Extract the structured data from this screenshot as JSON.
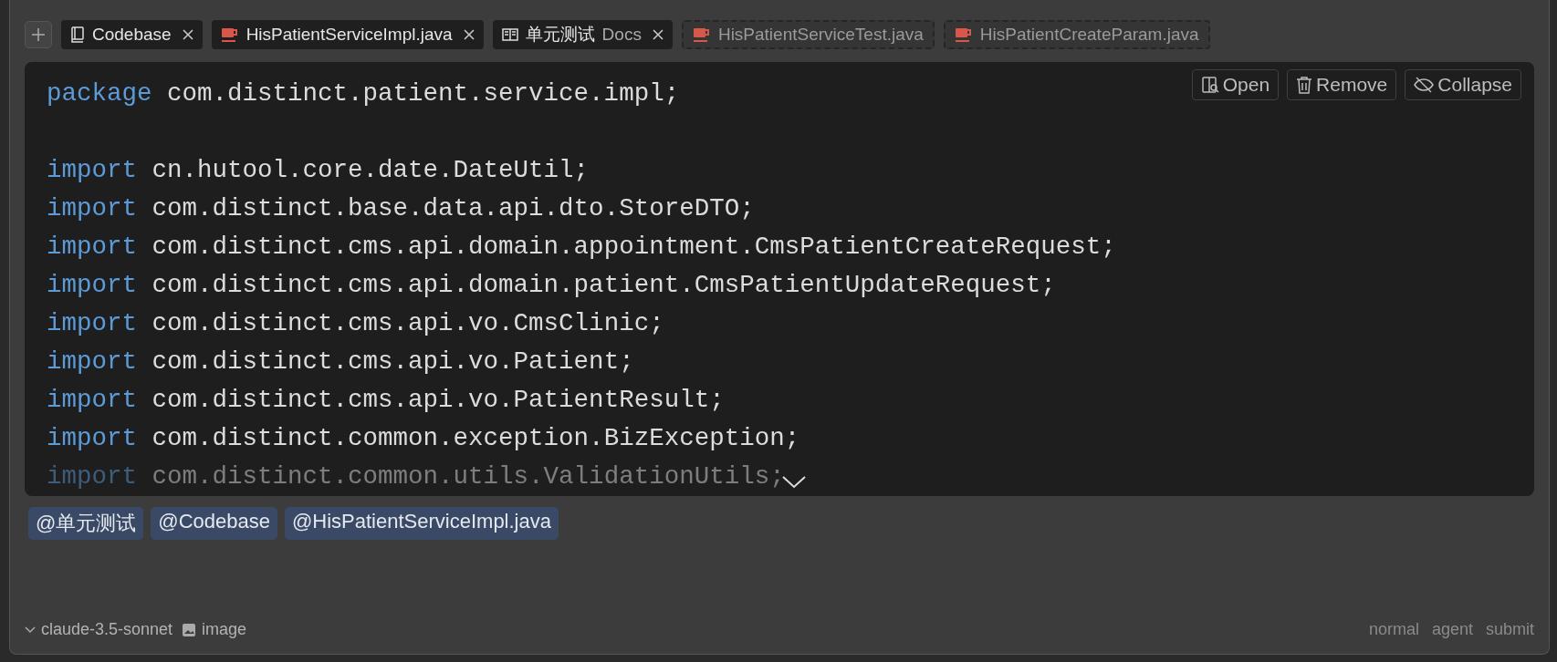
{
  "tabs": [
    {
      "kind": "codebase",
      "suggested": false,
      "label": "Codebase"
    },
    {
      "kind": "java",
      "suggested": false,
      "label": "HisPatientServiceImpl.java"
    },
    {
      "kind": "docs",
      "suggested": false,
      "label": "单元测试",
      "suffix": "Docs"
    },
    {
      "kind": "java",
      "suggested": true,
      "label": "HisPatientServiceTest.java"
    },
    {
      "kind": "java",
      "suggested": true,
      "label": "HisPatientCreateParam.java"
    }
  ],
  "code_actions": [
    {
      "label": "Open"
    },
    {
      "label": "Remove"
    },
    {
      "label": "Collapse"
    }
  ],
  "code_lines": [
    {
      "kind": "code",
      "keyword": "package",
      "rest": "com.distinct.patient.service.impl;",
      "faded": false
    },
    {
      "kind": "blank"
    },
    {
      "kind": "code",
      "keyword": "import",
      "rest": "cn.hutool.core.date.DateUtil;",
      "faded": false
    },
    {
      "kind": "code",
      "keyword": "import",
      "rest": "com.distinct.base.data.api.dto.StoreDTO;",
      "faded": false
    },
    {
      "kind": "code",
      "keyword": "import",
      "rest": "com.distinct.cms.api.domain.appointment.CmsPatientCreateRequest;",
      "faded": false
    },
    {
      "kind": "code",
      "keyword": "import",
      "rest": "com.distinct.cms.api.domain.patient.CmsPatientUpdateRequest;",
      "faded": false
    },
    {
      "kind": "code",
      "keyword": "import",
      "rest": "com.distinct.cms.api.vo.CmsClinic;",
      "faded": false
    },
    {
      "kind": "code",
      "keyword": "import",
      "rest": "com.distinct.cms.api.vo.Patient;",
      "faded": false
    },
    {
      "kind": "code",
      "keyword": "import",
      "rest": "com.distinct.cms.api.vo.PatientResult;",
      "faded": false
    },
    {
      "kind": "code",
      "keyword": "import",
      "rest": "com.distinct.common.exception.BizException;",
      "faded": false
    },
    {
      "kind": "code",
      "keyword": "import",
      "rest": "com.distinct.common.utils.ValidationUtils;",
      "faded": true
    }
  ],
  "mentions": [
    "@单元测试",
    "@Codebase",
    "@HisPatientServiceImpl.java"
  ],
  "footer": {
    "model": "claude-3.5-sonnet",
    "image": "image",
    "modes": [
      "normal",
      "agent",
      "submit"
    ]
  }
}
